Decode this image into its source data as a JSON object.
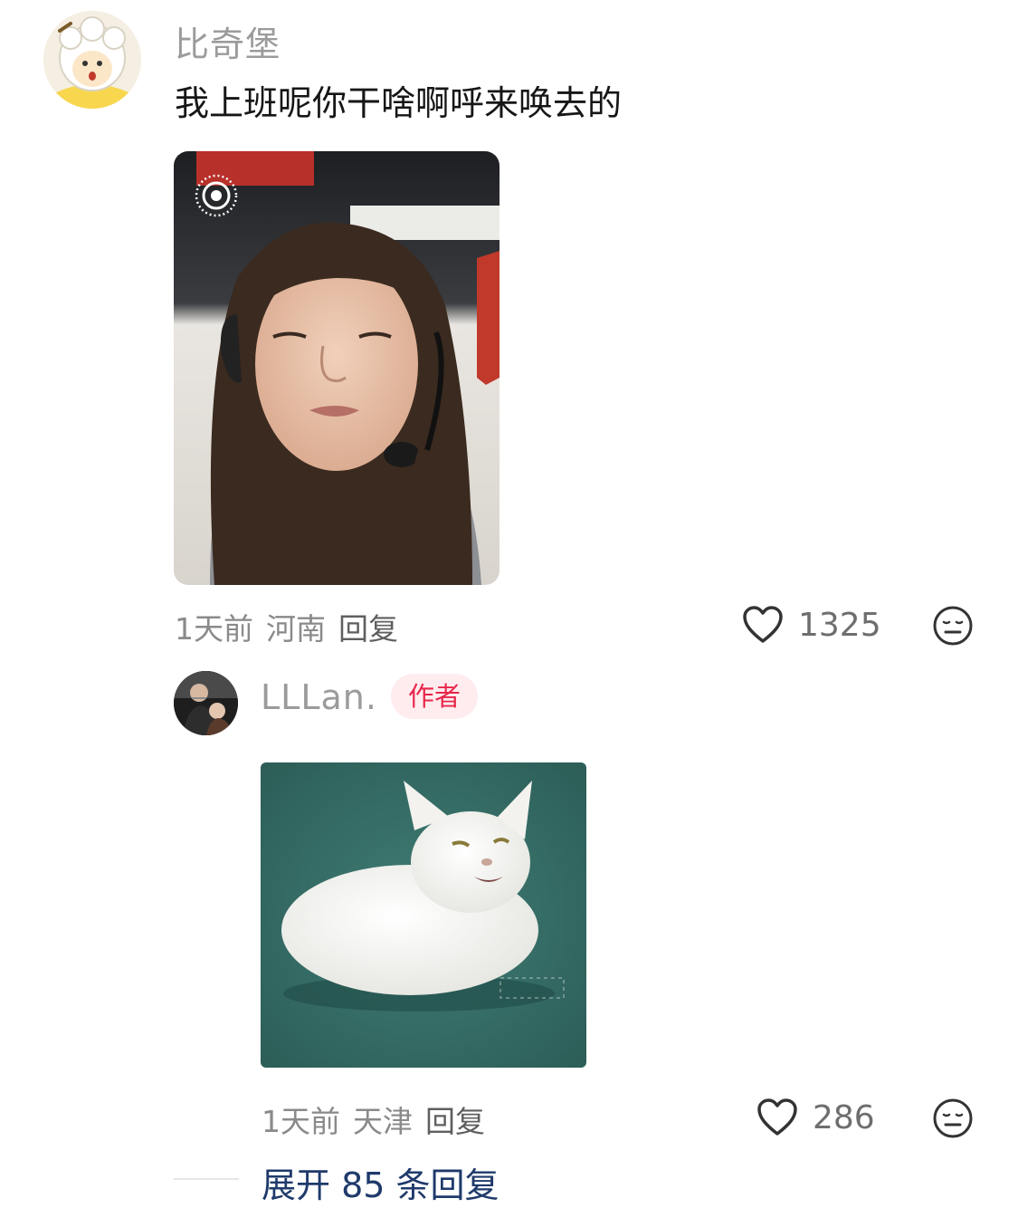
{
  "comment1": {
    "username": "比奇堡",
    "text": "我上班呢你干啥啊呼来唤去的",
    "time": "1天前",
    "location": "河南",
    "reply_label": "回复",
    "likes": "1325",
    "icons": [
      "heart-icon",
      "emoji-face-icon",
      "live-photo-icon"
    ]
  },
  "comment2": {
    "username": "LLLan.",
    "author_badge": "作者",
    "time": "1天前",
    "location": "天津",
    "reply_label": "回复",
    "likes": "286",
    "icons": [
      "heart-icon",
      "emoji-face-icon"
    ]
  },
  "expand_replies": "展开 85 条回复",
  "colors": {
    "author_badge_text": "#e8264a",
    "author_badge_bg": "#ffecef",
    "expand_link": "#1f3a6b",
    "username": "#9b9b9b"
  }
}
